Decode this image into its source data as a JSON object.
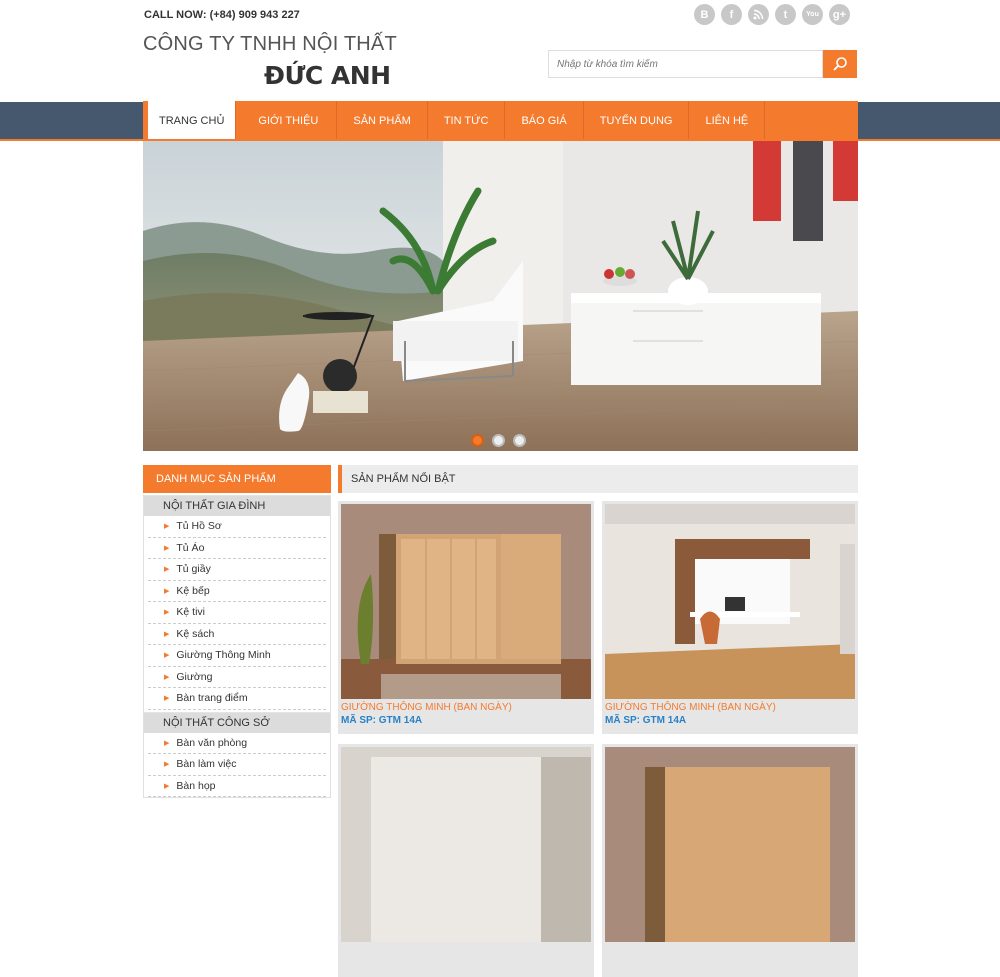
{
  "header": {
    "call_now": "CALL NOW: (+84) 909 943 227",
    "logo_line1": "CÔNG TY TNHH NỘI THẤT",
    "logo_line2": "ĐỨC ANH",
    "social": [
      {
        "icon": "blogger-icon",
        "glyph": "B"
      },
      {
        "icon": "facebook-icon",
        "glyph": "f"
      },
      {
        "icon": "rss-icon",
        "glyph": ")"
      },
      {
        "icon": "twitter-icon",
        "glyph": "t"
      },
      {
        "icon": "youtube-icon",
        "glyph": "You"
      },
      {
        "icon": "google-plus-icon",
        "glyph": "g+"
      }
    ],
    "search_placeholder": "Nhập từ khóa tìm kiếm"
  },
  "nav": {
    "items": [
      "TRANG CHỦ",
      "GIỚI THIỆU",
      "SẢN PHẨM",
      "TIN TỨC",
      "BÁO GIÁ",
      "TUYỂN DỤNG",
      "LIÊN HỆ"
    ],
    "active_index": 0
  },
  "slider": {
    "slide_count": 3,
    "active_slide": 1
  },
  "sidebar": {
    "title": "DANH MỤC SẢN PHẨM",
    "sections": [
      {
        "label": "NỘI THẤT GIA ĐÌNH",
        "items": [
          "Tủ Hồ Sơ",
          "Tủ Áo",
          "Tủ giầy",
          "Kệ bếp",
          "Kệ tivi",
          "Kệ sách",
          "Giường Thông Minh",
          "Giường",
          "Bàn trang điểm"
        ]
      },
      {
        "label": "NỘI THẤT CÔNG SỞ",
        "items": [
          "Bàn văn phòng",
          "Bàn làm việc",
          "Bàn họp"
        ]
      }
    ]
  },
  "featured": {
    "title": "SẢN PHẨM NỔI BẬT",
    "products": [
      {
        "name": "GIƯỜNG THÔNG MINH (BAN NGÀY)",
        "code": "MÃ SP: GTM 14A"
      },
      {
        "name": "GIƯỜNG THÔNG MINH (BAN NGÀY)",
        "code": "MÃ SP: GTM 14A"
      },
      {
        "name": "",
        "code": ""
      },
      {
        "name": "",
        "code": ""
      }
    ]
  },
  "colors": {
    "accent": "#f47a2d",
    "nav_band": "#46586d",
    "link": "#2a80c7"
  }
}
